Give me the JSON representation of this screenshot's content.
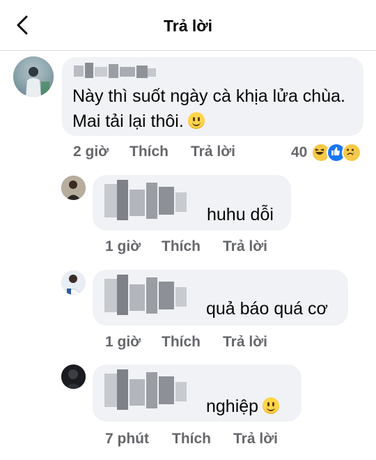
{
  "header": {
    "title": "Trả lời"
  },
  "main_comment": {
    "text_line1": "Này thì suốt ngày cà khịa lửa chùa.",
    "text_line2": "Mai tải lại thôi.",
    "time": "2 giờ",
    "like_label": "Thích",
    "reply_label": "Trả lời",
    "reaction_count": "40",
    "reactions": [
      "haha-icon",
      "like-icon",
      "sad-icon"
    ]
  },
  "replies": [
    {
      "text": "huhu dỗi",
      "time": "1 giờ",
      "like_label": "Thích",
      "reply_label": "Trả lời"
    },
    {
      "text": "quả báo quá cơ",
      "time": "1 giờ",
      "like_label": "Thích",
      "reply_label": "Trả lời"
    },
    {
      "text": "nghiệp",
      "time": "7 phút",
      "like_label": "Thích",
      "reply_label": "Trả lời",
      "emoji": "smile-emoji"
    }
  ],
  "colors": {
    "bubble": "#f0f2f5",
    "meta_text": "#65676b",
    "text": "#050505",
    "divider": "#dadde1"
  }
}
